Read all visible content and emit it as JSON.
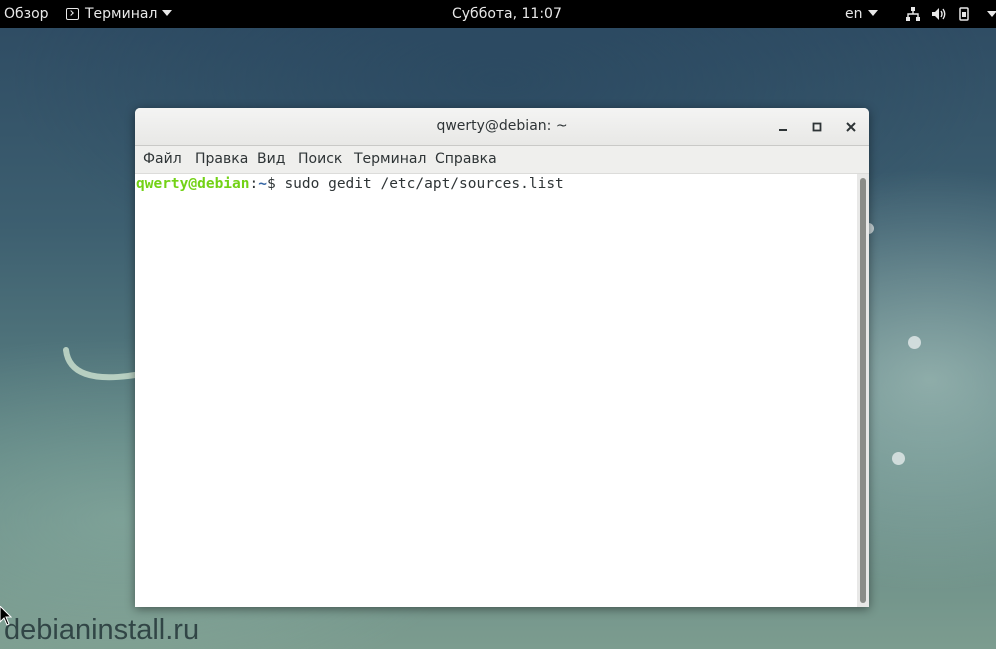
{
  "topbar": {
    "activities": "Обзор",
    "app_menu": "Терминал",
    "clock": "Суббота, 11:07",
    "language": "en",
    "icons": [
      "network-icon",
      "volume-icon",
      "power-icon"
    ]
  },
  "window": {
    "title": "qwerty@debian: ~",
    "menu": [
      "Файл",
      "Правка",
      "Вид",
      "Поиск",
      "Терминал",
      "Справка"
    ]
  },
  "terminal": {
    "prompt_user": "qwerty@debian",
    "prompt_sep": ":",
    "prompt_path": "~",
    "prompt_symbol": "$ ",
    "command": "sudo gedit /etc/apt/sources.list"
  },
  "watermark": "debianinstall.ru",
  "colors": {
    "prompt_user": "#73d216",
    "prompt_path": "#3465a4",
    "topbar": "#000000"
  }
}
